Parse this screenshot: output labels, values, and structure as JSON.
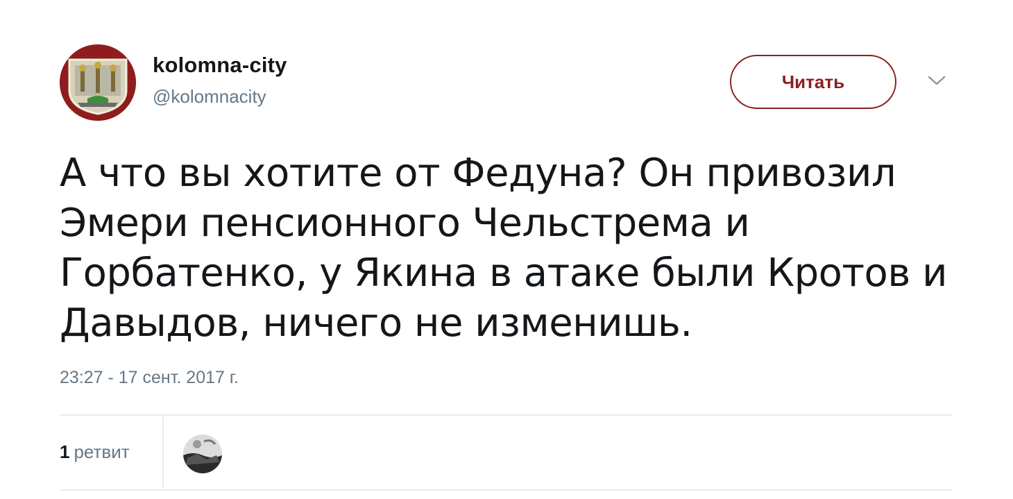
{
  "user": {
    "name": "kolomna-city",
    "handle": "@kolomnacity"
  },
  "follow_button": {
    "label": "Читать"
  },
  "tweet": {
    "text": "А что вы хотите от Федуна? Он привозил Эмери пенсионного Чельстрема и Горбатенко, у Якина в атаке были Кротов и Давыдов, ничего не изменишь.",
    "timestamp": "23:27 - 17 сент. 2017 г."
  },
  "stats": {
    "retweet_count": "1",
    "retweet_label": "ретвит"
  },
  "colors": {
    "accent": "#8a2020",
    "text": "#14171a",
    "secondary_text": "#657786",
    "divider": "#e6ecf0"
  },
  "icons": {
    "menu": "chevron-down-icon"
  }
}
